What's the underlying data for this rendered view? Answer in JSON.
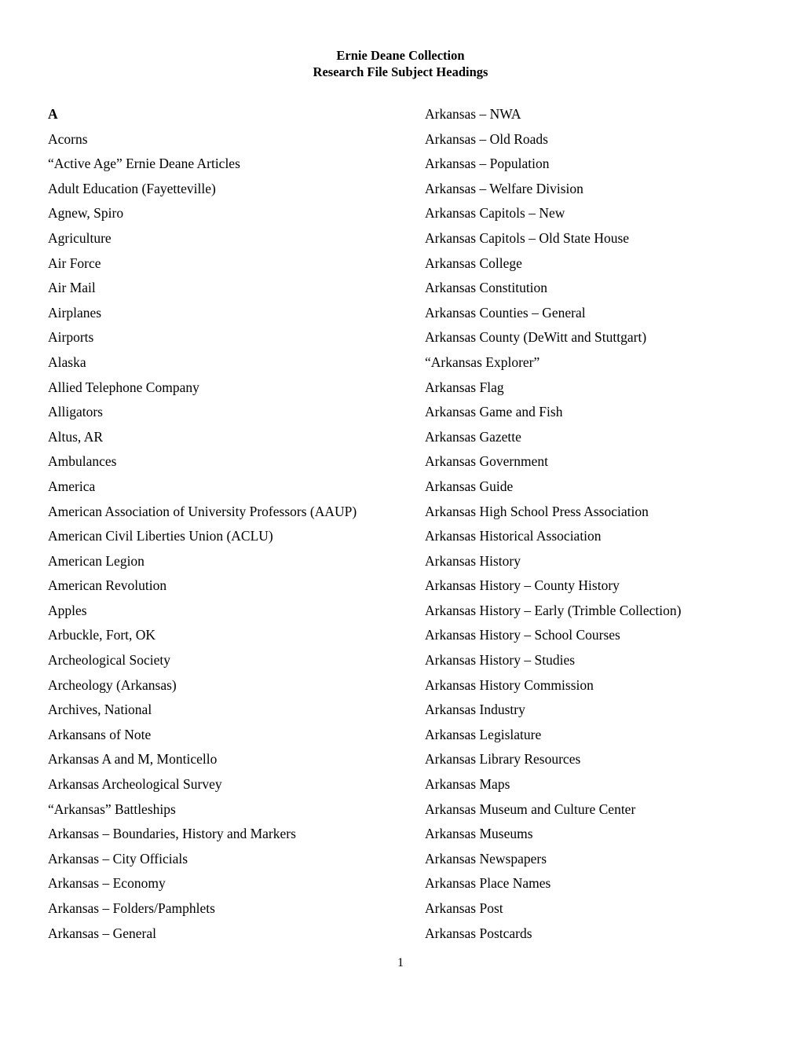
{
  "document": {
    "title": "Ernie Deane Collection",
    "subtitle": "Research File Subject Headings",
    "page_number": "1"
  },
  "left_column": {
    "section_letter": "A",
    "entries": [
      "Acorns",
      "“Active Age” Ernie Deane Articles",
      "Adult Education (Fayetteville)",
      "Agnew, Spiro",
      "Agriculture",
      "Air Force",
      "Air Mail",
      "Airplanes",
      "Airports",
      "Alaska",
      "Allied Telephone Company",
      "Alligators",
      "Altus, AR",
      "Ambulances",
      "America",
      "American Association of University Professors (AAUP)",
      "American Civil Liberties Union (ACLU)",
      "American Legion",
      "American Revolution",
      "Apples",
      "Arbuckle, Fort, OK",
      "Archeological Society",
      "Archeology (Arkansas)",
      "Archives, National",
      "Arkansans of Note",
      "Arkansas A and M, Monticello",
      "Arkansas Archeological Survey",
      "“Arkansas” Battleships",
      "Arkansas – Boundaries, History and Markers",
      "Arkansas – City Officials",
      "Arkansas – Economy",
      "Arkansas – Folders/Pamphlets",
      "Arkansas – General"
    ]
  },
  "right_column": {
    "entries": [
      "Arkansas – NWA",
      "Arkansas – Old Roads",
      "Arkansas – Population",
      "Arkansas – Welfare Division",
      "Arkansas Capitols – New",
      "Arkansas Capitols – Old State House",
      "Arkansas College",
      "Arkansas Constitution",
      "Arkansas Counties – General",
      "Arkansas County (DeWitt and Stuttgart)",
      "“Arkansas Explorer”",
      "Arkansas Flag",
      "Arkansas Game and Fish",
      "Arkansas Gazette",
      "Arkansas Government",
      "Arkansas Guide",
      "Arkansas High School Press Association",
      "Arkansas Historical Association",
      "Arkansas History",
      "Arkansas History – County History",
      "Arkansas History – Early (Trimble Collection)",
      "Arkansas History – School Courses",
      "Arkansas History – Studies",
      "Arkansas History Commission",
      "Arkansas Industry",
      "Arkansas Legislature",
      "Arkansas Library Resources",
      "Arkansas Maps",
      "Arkansas Museum and Culture Center",
      "Arkansas Museums",
      "Arkansas Newspapers",
      "Arkansas Place Names",
      "Arkansas Post",
      "Arkansas Postcards"
    ]
  }
}
